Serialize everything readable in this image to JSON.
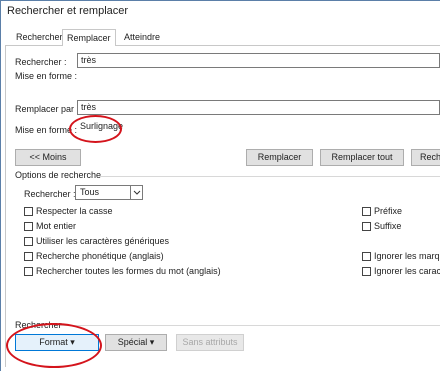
{
  "window": {
    "title": "Rechercher et remplacer"
  },
  "tabs": [
    {
      "label": "Rechercher"
    },
    {
      "label": "Remplacer"
    },
    {
      "label": "Atteindre"
    }
  ],
  "find": {
    "label": "Rechercher :",
    "value": "très",
    "format_label": "Mise en forme :"
  },
  "replace": {
    "label": "Remplacer par :",
    "value": "très",
    "format_label": "Mise en forme :",
    "format_value": "Surlignage"
  },
  "buttons": {
    "less": "<< Moins",
    "replace": "Remplacer",
    "replace_all": "Remplacer tout",
    "find_next_partial": "Rech",
    "format": "Format",
    "special": "Spécial",
    "no_format": "Sans attributs"
  },
  "options": {
    "header": "Options de recherche",
    "search_label": "Rechercher :",
    "search_value": "Tous",
    "left": [
      "Respecter la casse",
      "Mot entier",
      "Utiliser les caractères génériques",
      "Recherche phonétique (anglais)",
      "Rechercher toutes les formes du mot (anglais)"
    ],
    "right": [
      "Préfixe",
      "Suffixe",
      "Ignorer les marqu",
      "Ignorer les caract"
    ]
  },
  "bottom": {
    "section_label": "Rechercher"
  },
  "colors": {
    "annotation": "#d4141c",
    "frame": "#5b7fa8"
  }
}
